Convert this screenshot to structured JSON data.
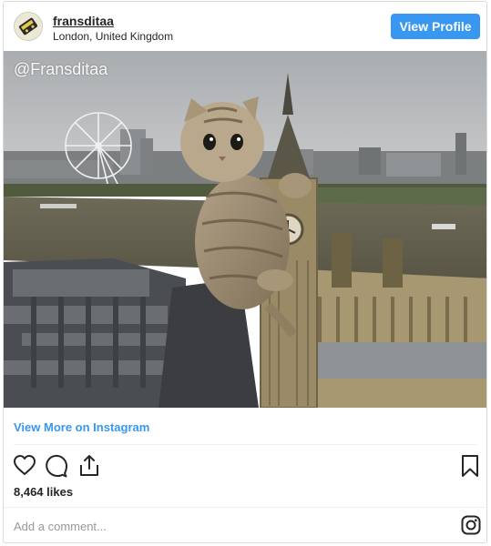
{
  "post": {
    "username": "fransditaa",
    "location": "London, United Kingdom",
    "view_profile_label": "View Profile",
    "watermark": "@Fransditaa",
    "view_more_label": "View More on Instagram",
    "likes": "8,464 likes",
    "comment_placeholder": "Add a comment..."
  },
  "icons": {
    "like": "heart-icon",
    "comment": "comment-icon",
    "share": "share-icon",
    "save": "bookmark-icon",
    "brand": "instagram-icon"
  },
  "colors": {
    "accent": "#3897f0",
    "text": "#262626",
    "border": "#dbdbdb",
    "placeholder": "#999999"
  }
}
